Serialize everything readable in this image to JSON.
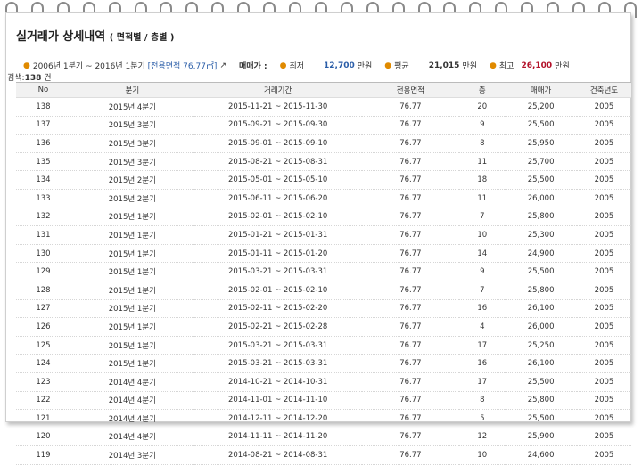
{
  "header": {
    "title": "실거래가 상세내역",
    "subtitle": "( 면적별 / 층별 )"
  },
  "summary": {
    "period": "2006년 1분기 ~ 2016년 1분기",
    "area_tag": "[전용면적 76.77㎡]",
    "count_label": "검색:",
    "count_value": "138",
    "count_unit": "건",
    "price_label": "매매가 :",
    "min_label": "최저",
    "min_value": "12,700",
    "avg_label": "평균",
    "avg_value": "21,015",
    "max_label": "최고",
    "max_value": "26,100",
    "unit": "만원"
  },
  "table": {
    "columns": [
      "No",
      "분기",
      "거래기간",
      "전용면적",
      "층",
      "매매가",
      "건축년도"
    ],
    "rows": [
      [
        "138",
        "2015년 4분기",
        "2015-11-21 ~ 2015-11-30",
        "76.77",
        "20",
        "25,200",
        "2005"
      ],
      [
        "137",
        "2015년 3분기",
        "2015-09-21 ~ 2015-09-30",
        "76.77",
        "9",
        "25,500",
        "2005"
      ],
      [
        "136",
        "2015년 3분기",
        "2015-09-01 ~ 2015-09-10",
        "76.77",
        "8",
        "25,950",
        "2005"
      ],
      [
        "135",
        "2015년 3분기",
        "2015-08-21 ~ 2015-08-31",
        "76.77",
        "11",
        "25,700",
        "2005"
      ],
      [
        "134",
        "2015년 2분기",
        "2015-05-01 ~ 2015-05-10",
        "76.77",
        "18",
        "25,500",
        "2005"
      ],
      [
        "133",
        "2015년 2분기",
        "2015-06-11 ~ 2015-06-20",
        "76.77",
        "11",
        "26,000",
        "2005"
      ],
      [
        "132",
        "2015년 1분기",
        "2015-02-01 ~ 2015-02-10",
        "76.77",
        "7",
        "25,800",
        "2005"
      ],
      [
        "131",
        "2015년 1분기",
        "2015-01-21 ~ 2015-01-31",
        "76.77",
        "10",
        "25,300",
        "2005"
      ],
      [
        "130",
        "2015년 1분기",
        "2015-01-11 ~ 2015-01-20",
        "76.77",
        "14",
        "24,900",
        "2005"
      ],
      [
        "129",
        "2015년 1분기",
        "2015-03-21 ~ 2015-03-31",
        "76.77",
        "9",
        "25,500",
        "2005"
      ],
      [
        "128",
        "2015년 1분기",
        "2015-02-01 ~ 2015-02-10",
        "76.77",
        "7",
        "25,800",
        "2005"
      ],
      [
        "127",
        "2015년 1분기",
        "2015-02-11 ~ 2015-02-20",
        "76.77",
        "16",
        "26,100",
        "2005"
      ],
      [
        "126",
        "2015년 1분기",
        "2015-02-21 ~ 2015-02-28",
        "76.77",
        "4",
        "26,000",
        "2005"
      ],
      [
        "125",
        "2015년 1분기",
        "2015-03-21 ~ 2015-03-31",
        "76.77",
        "17",
        "25,250",
        "2005"
      ],
      [
        "124",
        "2015년 1분기",
        "2015-03-21 ~ 2015-03-31",
        "76.77",
        "16",
        "26,100",
        "2005"
      ],
      [
        "123",
        "2014년 4분기",
        "2014-10-21 ~ 2014-10-31",
        "76.77",
        "17",
        "25,500",
        "2005"
      ],
      [
        "122",
        "2014년 4분기",
        "2014-11-01 ~ 2014-11-10",
        "76.77",
        "8",
        "25,800",
        "2005"
      ],
      [
        "121",
        "2014년 4분기",
        "2014-12-11 ~ 2014-12-20",
        "76.77",
        "5",
        "25,500",
        "2005"
      ],
      [
        "120",
        "2014년 4분기",
        "2014-11-11 ~ 2014-11-20",
        "76.77",
        "12",
        "25,900",
        "2005"
      ],
      [
        "119",
        "2014년 3분기",
        "2014-08-21 ~ 2014-08-31",
        "76.77",
        "10",
        "24,600",
        "2005"
      ]
    ]
  }
}
